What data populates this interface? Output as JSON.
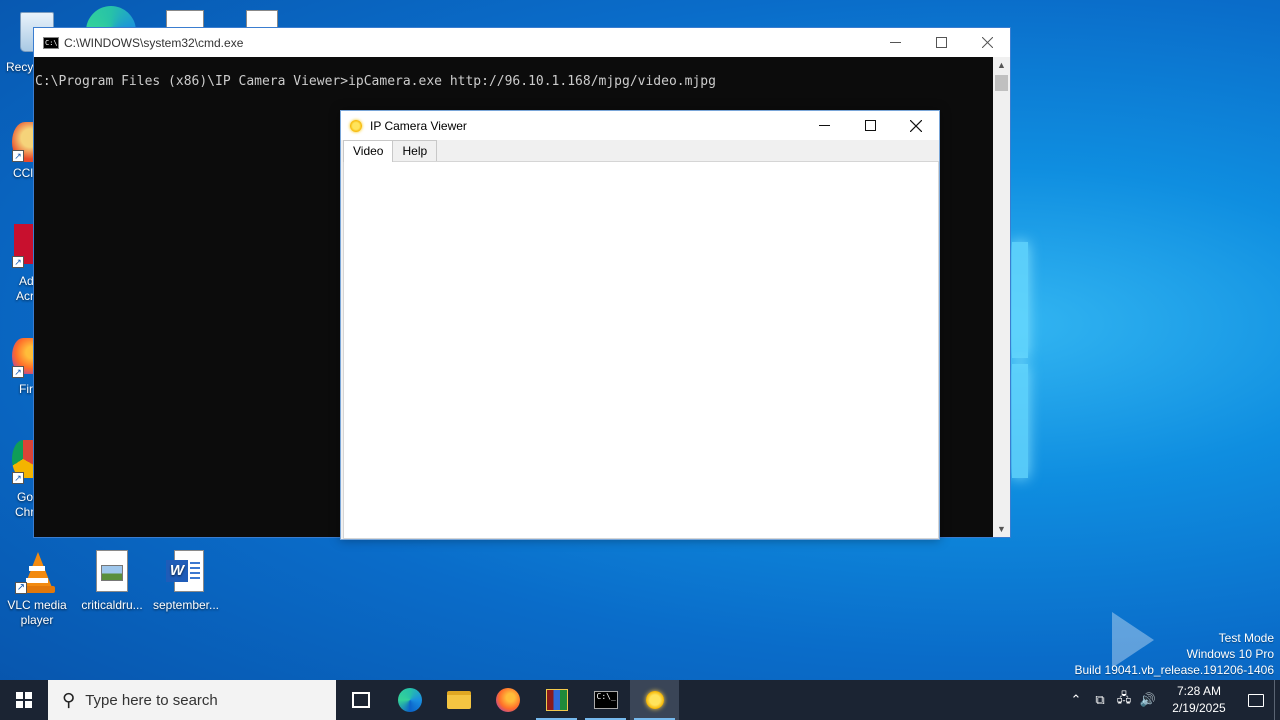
{
  "desktop": {
    "partial_labels": {
      "recycle": "Recy",
      "ccleaner": "CCl",
      "adobe_1": "Ad",
      "adobe_2": "Acr",
      "firefox": "Fir",
      "chrome_1": "Goo",
      "chrome_2": "Chr"
    },
    "icons": [
      {
        "label_1": "VLC media",
        "label_2": "player",
        "icon": "vlc-icon"
      },
      {
        "label_1": "criticaldru...",
        "icon": "image-file-icon"
      },
      {
        "label_1": "september...",
        "icon": "word-doc-icon"
      }
    ]
  },
  "cmd_window": {
    "title": "C:\\WINDOWS\\system32\\cmd.exe",
    "console_line": "C:\\Program Files (x86)\\IP Camera Viewer>ipCamera.exe http://96.10.1.168/mjpg/video.mjpg"
  },
  "ipcam_window": {
    "title": "IP Camera Viewer",
    "tabs": [
      {
        "label": "Video",
        "active": true
      },
      {
        "label": "Help",
        "active": false
      }
    ]
  },
  "watermark": {
    "line1": "Test Mode",
    "line2": "Windows 10 Pro",
    "line3": "Build 19041.vb_release.191206-1406",
    "brand": "ANY RUN"
  },
  "taskbar": {
    "search_placeholder": "Type here to search",
    "time": "7:28 AM",
    "date": "2/19/2025"
  }
}
